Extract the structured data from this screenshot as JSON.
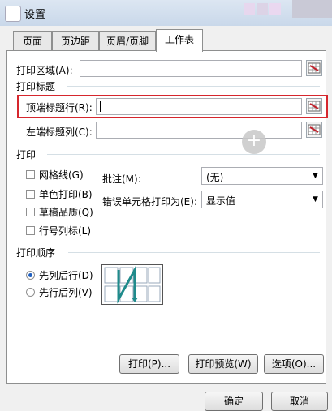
{
  "window": {
    "title": "设置"
  },
  "tabs": [
    {
      "label": "页面"
    },
    {
      "label": "页边距"
    },
    {
      "label": "页眉/页脚"
    },
    {
      "label": "工作表"
    }
  ],
  "print_area": {
    "label": "打印区域(A):",
    "value": ""
  },
  "print_titles": {
    "section": "打印标题",
    "rows_label": "顶端标题行(R):",
    "rows_value": "",
    "cols_label": "左端标题列(C):",
    "cols_value": ""
  },
  "print": {
    "section": "打印",
    "gridlines": "网格线(G)",
    "bw": "单色打印(B)",
    "draft": "草稿品质(Q)",
    "headings": "行号列标(L)",
    "comments_label": "批注(M):",
    "comments_value": "(无)",
    "errors_label": "错误单元格打印为(E):",
    "errors_value": "显示值"
  },
  "order": {
    "section": "打印顺序",
    "down_then_over": "先列后行(D)",
    "over_then_down": "先行后列(V)",
    "selected": "down_then_over"
  },
  "buttons": {
    "print": "打印(P)...",
    "preview": "打印预览(W)",
    "options": "选项(O)...",
    "ok": "确定",
    "cancel": "取消"
  }
}
